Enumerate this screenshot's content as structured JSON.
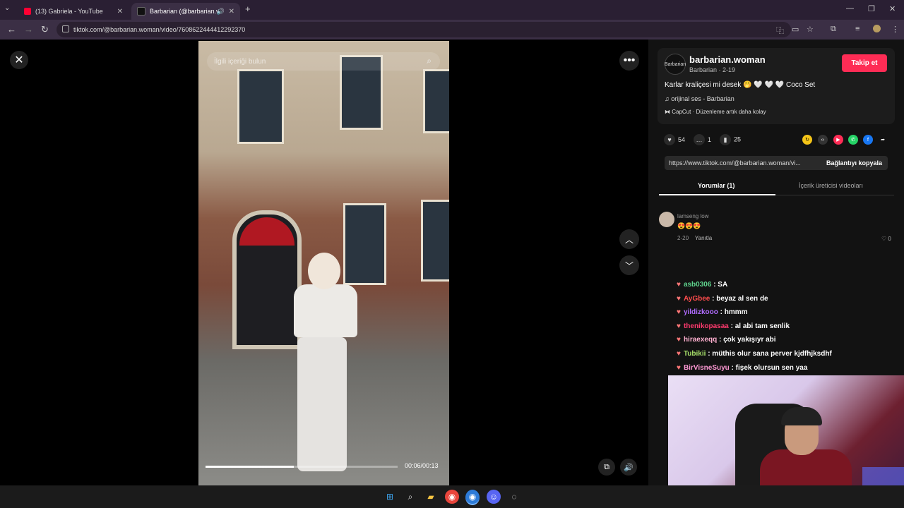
{
  "browser": {
    "tabs": [
      {
        "title": "(13) Gabriela - YouTube"
      },
      {
        "title": "Barbarian (@barbarian.wom"
      }
    ],
    "url": "tiktok.com/@barbarian.woman/video/7608622444412292370"
  },
  "video": {
    "search_placeholder": "İlgili içeriği bulun",
    "time": "00:06/00:13",
    "progress": 0.46
  },
  "profile": {
    "avatar_text": "Barbarian",
    "username": "barbarian.woman",
    "subtitle": "Barbarian · 2-19",
    "follow_label": "Takip et",
    "description": "Karlar kraliçesi mi desek 🤭 🤍 🤍 🤍 Coco Set",
    "music": "orijinal ses - Barbarian",
    "capcut": "CapCut · Düzenleme artık daha kolay"
  },
  "stats": {
    "likes": "54",
    "comments": "1",
    "saves": "25"
  },
  "link": {
    "url": "https://www.tiktok.com/@barbarian.woman/vi...",
    "copy_label": "Bağlantıyı kopyala"
  },
  "tabs": {
    "comments": "Yorumlar (1)",
    "creator_videos": "İçerik üreticisi videoları"
  },
  "comment": {
    "user": "lamseng low",
    "text": "😍😍😍",
    "date": "2-20",
    "reply": "Yanıtla",
    "likes": "0"
  },
  "chat": [
    {
      "user": "asb0306",
      "msg": "SA",
      "color": "#5fd38d"
    },
    {
      "user": "AyGbee",
      "msg": "beyaz al sen de",
      "color": "#ff4d4d"
    },
    {
      "user": "yildizkooo",
      "msg": "hmmm",
      "color": "#b06cff"
    },
    {
      "user": "thenikopasaa",
      "msg": "al abi tam senlik",
      "color": "#ff3a6e"
    },
    {
      "user": "hiraexeqq",
      "msg": "çok yakışıyr abi",
      "color": "#ffb0d0"
    },
    {
      "user": "Tubikii",
      "msg": "müthis olur sana perver kjdfhjksdhf",
      "color": "#a8e06a"
    },
    {
      "user": "BirVisneSuyu",
      "msg": "fişek olursun sen yaa",
      "color": "#ff9ad5"
    }
  ]
}
